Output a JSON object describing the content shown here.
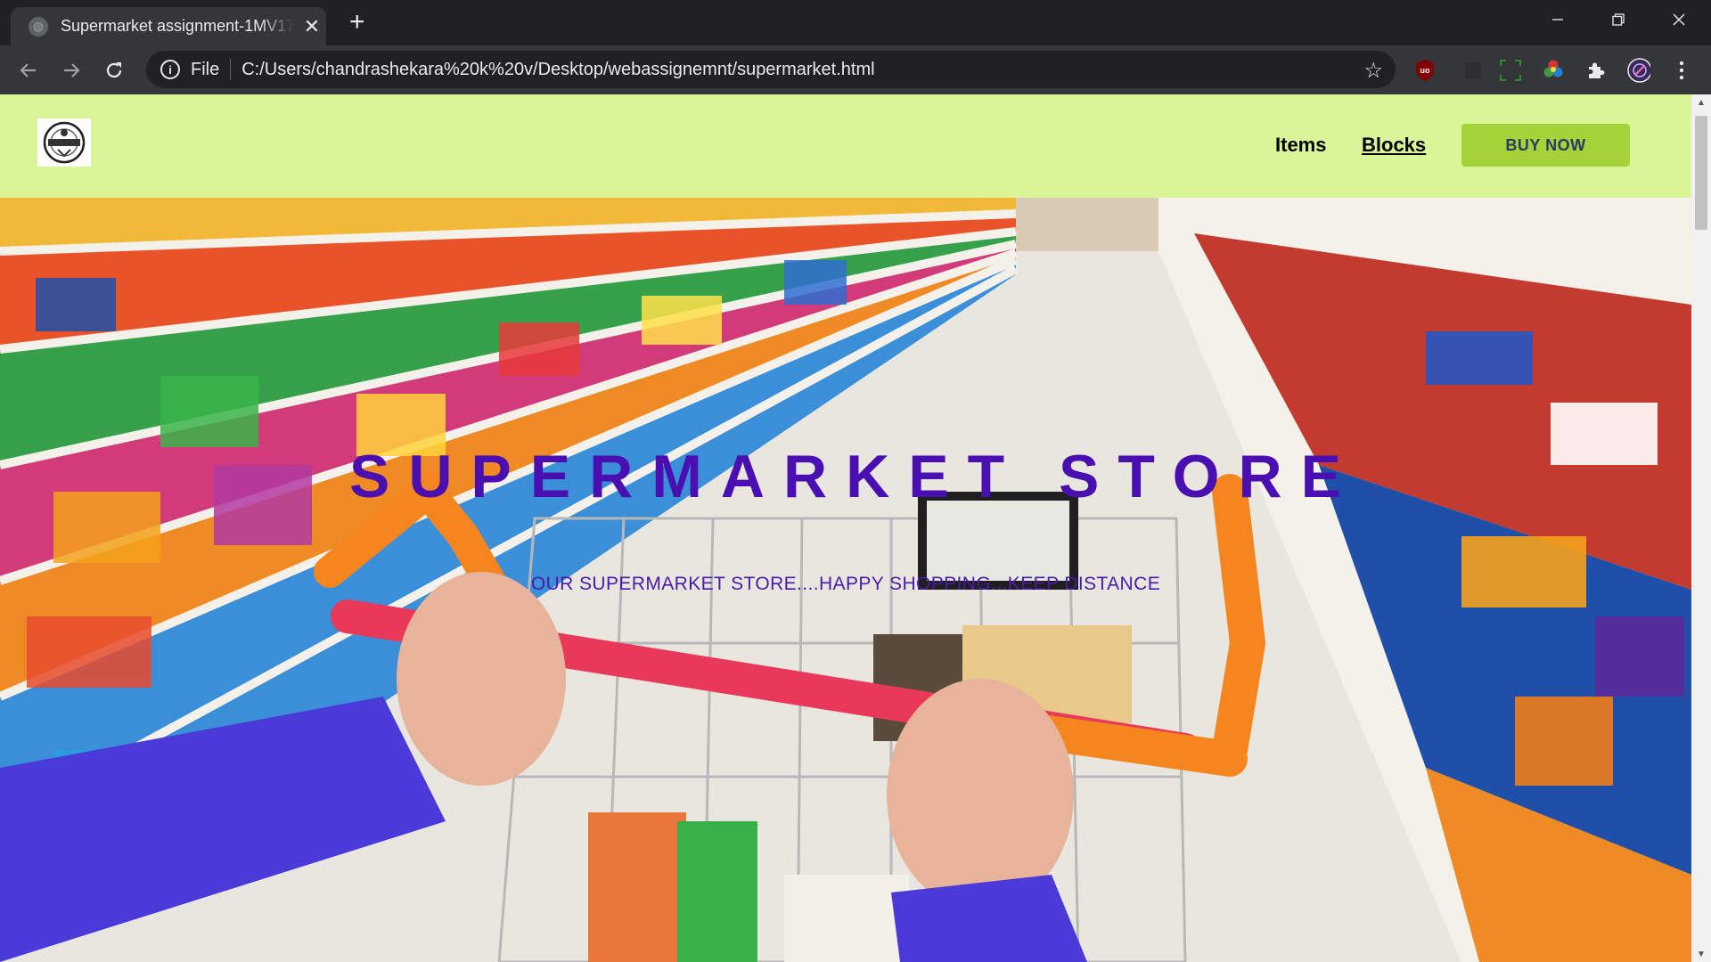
{
  "browser": {
    "tab_title": "Supermarket assignment-1MV17",
    "tab_close": "✕",
    "new_tab": "+",
    "omnibox": {
      "scheme_label": "File",
      "url": "C:/Users/chandrashekara%20k%20v/Desktop/webassignemnt/supermarket.html"
    },
    "extension_badge": "uo"
  },
  "page": {
    "nav": {
      "items": [
        {
          "label": "Items"
        },
        {
          "label": "Blocks"
        }
      ],
      "buy_button": "BUY NOW"
    },
    "hero": {
      "title": "SUPERMARKET STORE",
      "subtitle": "OUR SUPERMARKET STORE....HAPPY SHOPPING...KEEP DISTANCE"
    }
  },
  "colors": {
    "navbar_bg": "#d9f597",
    "buy_button_bg": "#a5d238",
    "hero_title": "#4a0fb0"
  }
}
